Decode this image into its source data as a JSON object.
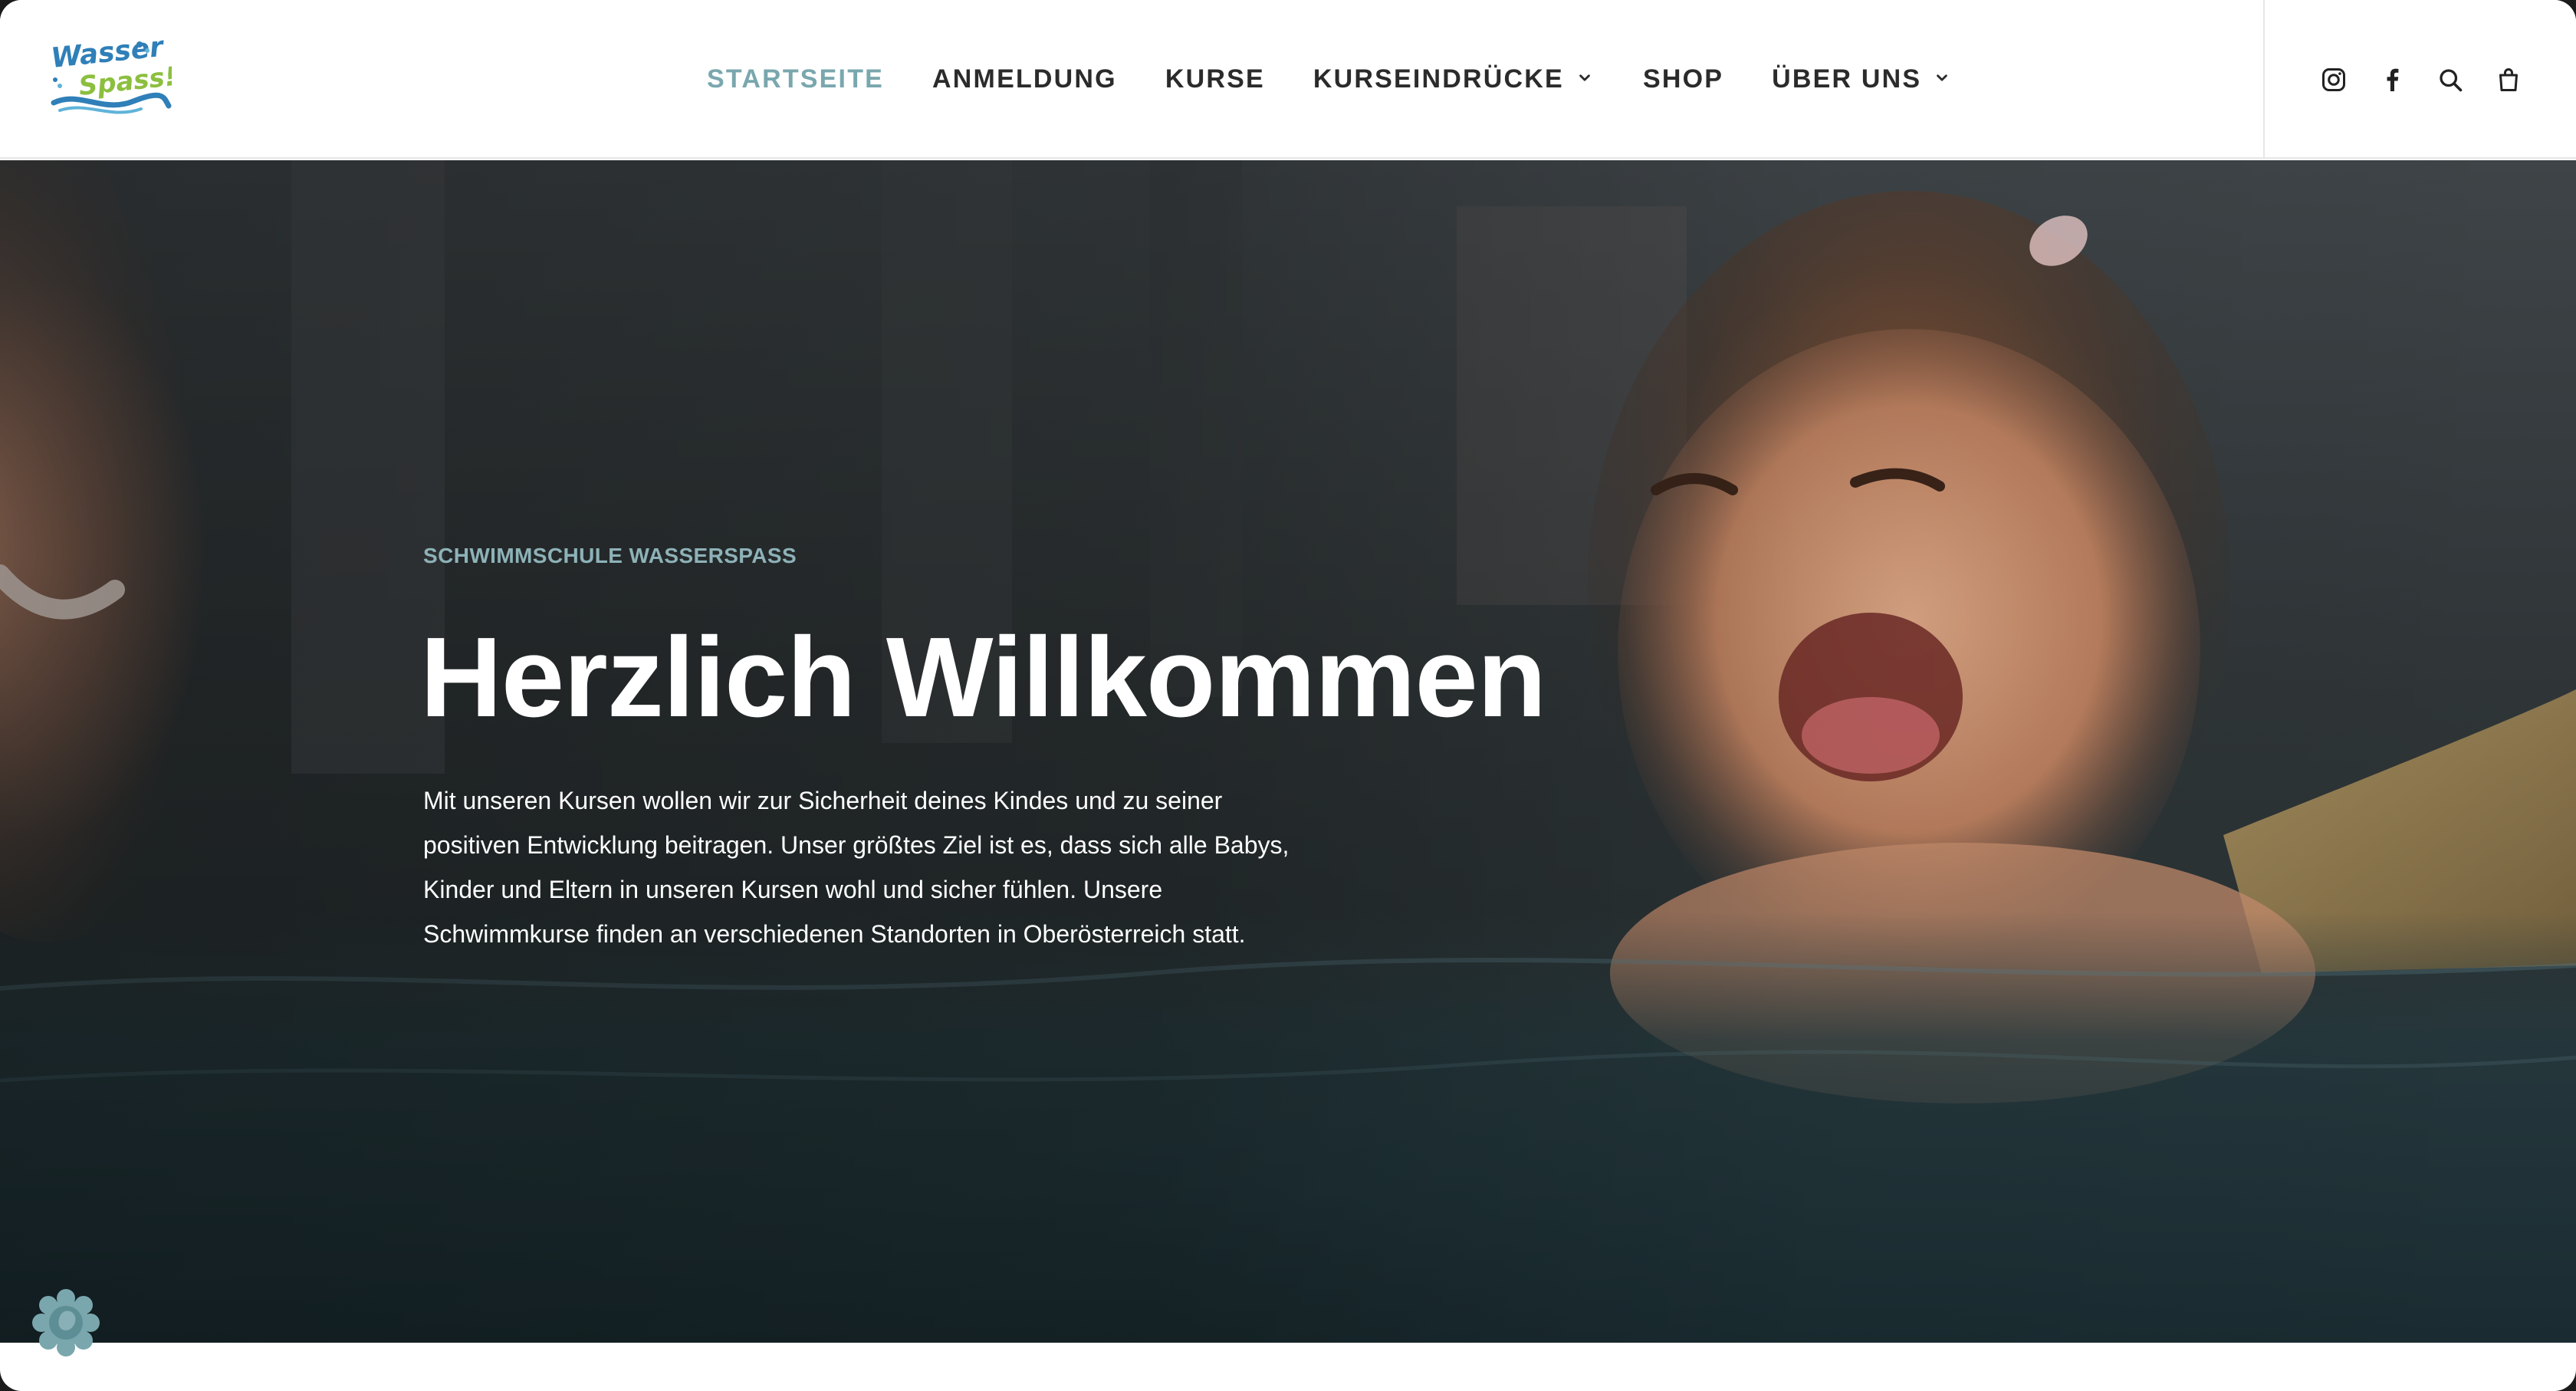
{
  "header": {
    "logo": {
      "text_line1": "Wasser",
      "text_line2": "Spass!",
      "icon": "wasserspass-logo"
    },
    "nav": [
      {
        "label": "STARTSEITE",
        "active": true,
        "has_dropdown": false
      },
      {
        "label": "ANMELDUNG",
        "active": false,
        "has_dropdown": false
      },
      {
        "label": "KURSE",
        "active": false,
        "has_dropdown": false
      },
      {
        "label": "KURSEINDRÜCKE",
        "active": false,
        "has_dropdown": true
      },
      {
        "label": "SHOP",
        "active": false,
        "has_dropdown": false
      },
      {
        "label": "ÜBER UNS",
        "active": false,
        "has_dropdown": true
      }
    ],
    "tools": [
      "instagram-icon",
      "facebook-icon",
      "search-icon",
      "shopping-bag-icon"
    ]
  },
  "hero": {
    "eyebrow": "SCHWIMMSCHULE WASSERSPASS",
    "headline": "Herzlich Willkommen",
    "intro": "Mit unseren Kursen wollen wir zur Sicherheit deines Kindes und zu seiner positiven Entwicklung beitragen. Unser größtes Ziel ist es, dass sich alle Babys, Kinder und Eltern in unseren Kursen wohl und sicher fühlen. Unsere Schwimmkurse finden an verschiedenen Standorten in Oberösterreich statt."
  },
  "cookie": {
    "icon": "cookie-settings-icon"
  },
  "colors": {
    "accent": "#7aa7ae",
    "eyebrow": "#8db2b8",
    "nav_text": "#2b2b2b",
    "headline": "#ffffff"
  }
}
